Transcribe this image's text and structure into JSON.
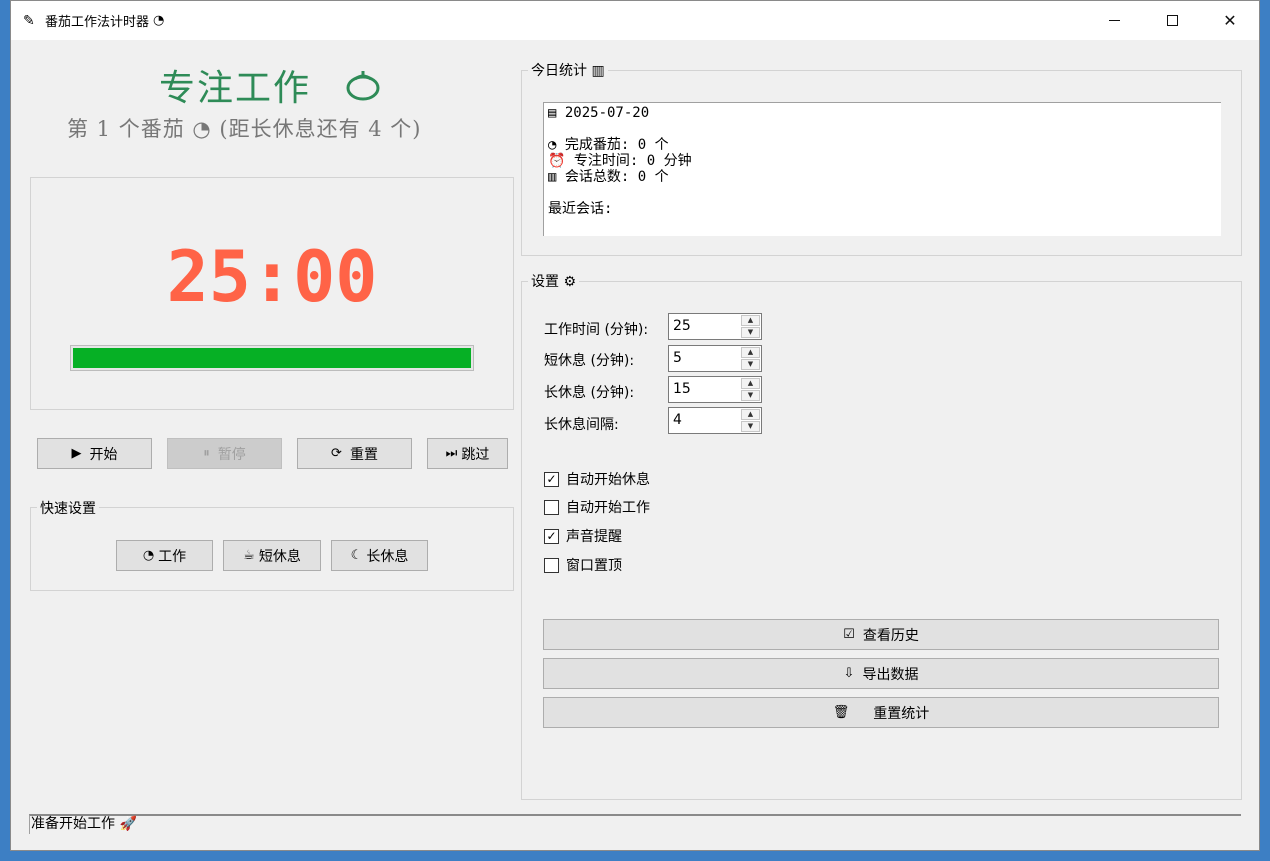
{
  "window": {
    "title": "番茄工作法计时器",
    "title_icon": "tomato-icon",
    "controls": {
      "minimize": "minimize-icon",
      "maximize": "maximize-icon",
      "close": "close-icon"
    }
  },
  "header": {
    "mode_title": "专注工作",
    "pomodoro_text": "第 1 个番茄 ◔ (距长休息还有 4 个)"
  },
  "timer": {
    "display": "25:00",
    "progress_percent": 100,
    "progress_color": "#06b025",
    "time_color": "#ff6347"
  },
  "controls": {
    "start": {
      "icon": "▶",
      "label": "开始"
    },
    "pause": {
      "icon": "⏸",
      "label": "暂停"
    },
    "reset": {
      "icon": "⟳",
      "label": "重置"
    },
    "skip": {
      "icon": "⏭",
      "label": "跳过"
    }
  },
  "quick_settings": {
    "label": "快速设置",
    "work": {
      "icon": "◔",
      "label": "工作"
    },
    "short_break": {
      "icon": "☕",
      "label": "短休息"
    },
    "long_break": {
      "icon": "☾",
      "label": "长休息"
    }
  },
  "stats": {
    "label": "今日统计 ▥",
    "date": "▤ 2025-07-20",
    "completed": "◔ 完成番茄: 0 个",
    "focus_time": "⏰ 专注时间: 0 分钟",
    "sessions": "▥ 会话总数: 0 个",
    "recent": "最近会话:"
  },
  "settings": {
    "label": "设置 ⚙",
    "work_time": {
      "label": "工作时间 (分钟):",
      "value": "25"
    },
    "short_break": {
      "label": "短休息 (分钟):",
      "value": "5"
    },
    "long_break": {
      "label": "长休息 (分钟):",
      "value": "15"
    },
    "interval": {
      "label": "长休息间隔:",
      "value": "4"
    },
    "auto_start_break": {
      "label": "自动开始休息",
      "checked": true
    },
    "auto_start_work": {
      "label": "自动开始工作",
      "checked": false
    },
    "sound_alert": {
      "label": "声音提醒",
      "checked": true
    },
    "always_on_top": {
      "label": "窗口置顶",
      "checked": false
    }
  },
  "actions": {
    "history": {
      "icon": "☑",
      "label": "查看历史"
    },
    "export": {
      "icon": "⇩",
      "label": "导出数据"
    },
    "reset_stats": {
      "icon": "🗑",
      "label": "重置统计"
    }
  },
  "status": {
    "text": "准备开始工作 🚀"
  }
}
